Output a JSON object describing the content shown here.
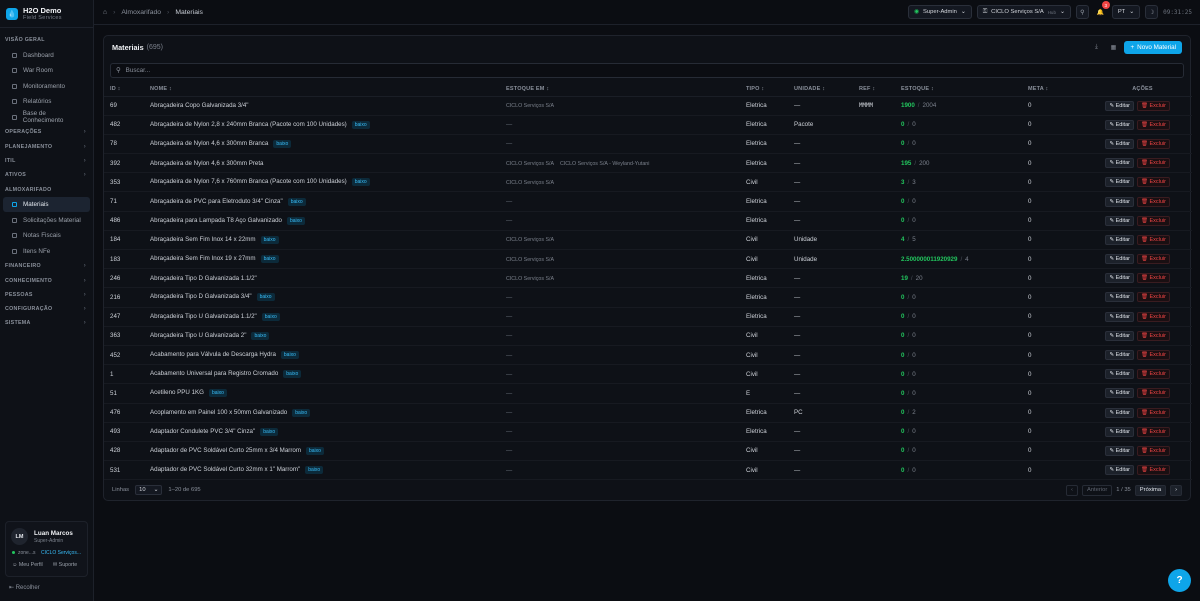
{
  "app": {
    "name": "H2O Demo",
    "subtitle": "Field Services"
  },
  "sidebar": {
    "sections": [
      {
        "label": "VISÃO GERAL",
        "items": [
          {
            "label": "Dashboard",
            "icon": "grid-icon"
          },
          {
            "label": "War Room",
            "icon": "monitor-icon"
          },
          {
            "label": "Monitoramento",
            "icon": "activity-icon"
          },
          {
            "label": "Relatórios",
            "icon": "chart-icon"
          },
          {
            "label": "Base de Conhecimento",
            "icon": "book-icon"
          }
        ]
      },
      {
        "label": "OPERAÇÕES",
        "items": []
      },
      {
        "label": "PLANEJAMENTO",
        "items": []
      },
      {
        "label": "ITIL",
        "items": []
      },
      {
        "label": "ATIVOS",
        "items": []
      },
      {
        "label": "ALMOXARIFADO",
        "items": [
          {
            "label": "Materiais",
            "icon": "box-icon",
            "active": true
          },
          {
            "label": "Solicitações Material",
            "icon": "clipboard-icon"
          },
          {
            "label": "Notas Fiscais",
            "icon": "receipt-icon"
          },
          {
            "label": "Itens NFe",
            "icon": "list-icon"
          }
        ]
      },
      {
        "label": "FINANCEIRO",
        "items": []
      },
      {
        "label": "CONHECIMENTO",
        "items": []
      },
      {
        "label": "PESSOAS",
        "items": []
      },
      {
        "label": "CONFIGURAÇÃO",
        "items": []
      },
      {
        "label": "SISTEMA",
        "items": []
      }
    ]
  },
  "user": {
    "initials": "LM",
    "name": "Luan Marcos",
    "role": "Super-Admin",
    "context": "zone...s",
    "org": "CICLO Serviços...",
    "profile_link": "Meu Perfil",
    "support_link": "Suporte"
  },
  "collapse_label": "Recolher",
  "breadcrumb": {
    "items": [
      "Almoxarifado",
      "Materiais"
    ]
  },
  "topbar": {
    "role": "Super-Admin",
    "tenant": "CICLO Serviços S/A",
    "tenant_badge": "Hub",
    "notifications": "3",
    "lang": "PT",
    "clock": "09:31:25"
  },
  "panel": {
    "title": "Materiais",
    "count": "(695)",
    "new_button": "Novo Material",
    "search_placeholder": "Buscar..."
  },
  "table": {
    "columns": [
      "ID",
      "NOME",
      "ESTOQUE EM",
      "TIPO",
      "UNIDADE",
      "REF",
      "ESTOQUE",
      "META",
      "AÇÕES"
    ],
    "edit_label": "Editar",
    "delete_label": "Excluir",
    "rows": [
      {
        "id": "69",
        "nome": "Abraçadeira Copo Galvanizada 3/4\"",
        "tag": "",
        "estoque_em": [
          "CICLO Serviços S/A"
        ],
        "tipo": "Eletrica",
        "unidade": "—",
        "ref": "MMMM",
        "qty": "1900",
        "cap": "2004",
        "meta": "0"
      },
      {
        "id": "482",
        "nome": "Abraçadeira de Nylon 2,8 x 240mm Branca (Pacote com 100 Unidades)",
        "tag": "baixo",
        "estoque_em": [
          "—"
        ],
        "tipo": "Eletrica",
        "unidade": "Pacote",
        "ref": "",
        "qty": "0",
        "cap": "0",
        "meta": "0"
      },
      {
        "id": "78",
        "nome": "Abraçadeira de Nylon 4,6 x 300mm Branca",
        "tag": "baixo",
        "estoque_em": [
          "—"
        ],
        "tipo": "Eletrica",
        "unidade": "—",
        "ref": "",
        "qty": "0",
        "cap": "0",
        "meta": "0"
      },
      {
        "id": "392",
        "nome": "Abraçadeira de Nylon 4,6 x 300mm Preta",
        "tag": "",
        "estoque_em": [
          "CICLO Serviços S/A",
          "CICLO Serviços S/A - Weyland-Yutani"
        ],
        "tipo": "Eletrica",
        "unidade": "—",
        "ref": "",
        "qty": "195",
        "cap": "200",
        "meta": "0"
      },
      {
        "id": "353",
        "nome": "Abraçadeira de Nylon 7,6 x 760mm Branca (Pacote com 100 Unidades)",
        "tag": "baixo",
        "estoque_em": [
          "CICLO Serviços S/A"
        ],
        "tipo": "Civil",
        "unidade": "—",
        "ref": "",
        "qty": "3",
        "cap": "3",
        "meta": "0"
      },
      {
        "id": "71",
        "nome": "Abraçadeira de PVC para Eletroduto 3/4\" Cinza\"",
        "tag": "baixo",
        "estoque_em": [
          "—"
        ],
        "tipo": "Eletrica",
        "unidade": "—",
        "ref": "",
        "qty": "0",
        "cap": "0",
        "meta": "0"
      },
      {
        "id": "486",
        "nome": "Abraçadeira para Lampada T8 Aço Galvanizado",
        "tag": "baixo",
        "estoque_em": [
          "—"
        ],
        "tipo": "Eletrica",
        "unidade": "—",
        "ref": "",
        "qty": "0",
        "cap": "0",
        "meta": "0"
      },
      {
        "id": "184",
        "nome": "Abraçadeira Sem Fim Inox 14 x 22mm",
        "tag": "baixo",
        "estoque_em": [
          "CICLO Serviços S/A"
        ],
        "tipo": "Civil",
        "unidade": "Unidade",
        "ref": "",
        "qty": "4",
        "cap": "5",
        "meta": "0"
      },
      {
        "id": "183",
        "nome": "Abraçadeira Sem Fim Inox 19 x 27mm",
        "tag": "baixo",
        "estoque_em": [
          "CICLO Serviços S/A"
        ],
        "tipo": "Civil",
        "unidade": "Unidade",
        "ref": "",
        "qty": "2.500000011920929",
        "cap": "4",
        "meta": "0"
      },
      {
        "id": "246",
        "nome": "Abraçadeira Tipo D Galvanizada 1.1/2\"",
        "tag": "",
        "estoque_em": [
          "CICLO Serviços S/A"
        ],
        "tipo": "Eletrica",
        "unidade": "—",
        "ref": "",
        "qty": "19",
        "cap": "20",
        "meta": "0"
      },
      {
        "id": "216",
        "nome": "Abraçadeira Tipo D Galvanizada 3/4\"",
        "tag": "baixo",
        "estoque_em": [
          "—"
        ],
        "tipo": "Eletrica",
        "unidade": "—",
        "ref": "",
        "qty": "0",
        "cap": "0",
        "meta": "0"
      },
      {
        "id": "247",
        "nome": "Abraçadeira Tipo U Galvanizada 1.1/2\"",
        "tag": "baixo",
        "estoque_em": [
          "—"
        ],
        "tipo": "Eletrica",
        "unidade": "—",
        "ref": "",
        "qty": "0",
        "cap": "0",
        "meta": "0"
      },
      {
        "id": "363",
        "nome": "Abraçadeira Tipo U Galvanizada 2\"",
        "tag": "baixo",
        "estoque_em": [
          "—"
        ],
        "tipo": "Civil",
        "unidade": "—",
        "ref": "",
        "qty": "0",
        "cap": "0",
        "meta": "0"
      },
      {
        "id": "452",
        "nome": "Acabamento para Válvula de Descarga Hydra",
        "tag": "baixo",
        "estoque_em": [
          "—"
        ],
        "tipo": "Civil",
        "unidade": "—",
        "ref": "",
        "qty": "0",
        "cap": "0",
        "meta": "0"
      },
      {
        "id": "1",
        "nome": "Acabamento Universal para Registro Cromado",
        "tag": "baixo",
        "estoque_em": [
          "—"
        ],
        "tipo": "Civil",
        "unidade": "—",
        "ref": "",
        "qty": "0",
        "cap": "0",
        "meta": "0"
      },
      {
        "id": "51",
        "nome": "Acetileno PPU 1KG",
        "tag": "baixo",
        "estoque_em": [
          "—"
        ],
        "tipo": "E",
        "unidade": "—",
        "ref": "",
        "qty": "0",
        "cap": "0",
        "meta": "0"
      },
      {
        "id": "476",
        "nome": "Acoplamento em Painel 100 x 50mm Galvanizado",
        "tag": "baixo",
        "estoque_em": [
          "—"
        ],
        "tipo": "Eletrica",
        "unidade": "PC",
        "ref": "",
        "qty": "0",
        "cap": "2",
        "meta": "0"
      },
      {
        "id": "493",
        "nome": "Adaptador Condulete PVC 3/4\" Cinza\"",
        "tag": "baixo",
        "estoque_em": [
          "—"
        ],
        "tipo": "Eletrica",
        "unidade": "—",
        "ref": "",
        "qty": "0",
        "cap": "0",
        "meta": "0"
      },
      {
        "id": "428",
        "nome": "Adaptador de PVC Soldável Curto 25mm x 3/4 Marrom",
        "tag": "baixo",
        "estoque_em": [
          "—"
        ],
        "tipo": "Civil",
        "unidade": "—",
        "ref": "",
        "qty": "0",
        "cap": "0",
        "meta": "0"
      },
      {
        "id": "531",
        "nome": "Adaptador de PVC Soldável Curto 32mm x 1\" Marrom\"",
        "tag": "baixo",
        "estoque_em": [
          "—"
        ],
        "tipo": "Civil",
        "unidade": "—",
        "ref": "",
        "qty": "0",
        "cap": "0",
        "meta": "0"
      }
    ]
  },
  "footer": {
    "rows_label": "Linhas",
    "rows_value": "10",
    "range": "1–20 de 695",
    "prev": "Anterior",
    "page": "1 / 35",
    "next": "Próxima"
  },
  "colors": {
    "accent": "#0ea5e9",
    "stock_ok": "#22c55e",
    "danger": "#ef4444"
  }
}
